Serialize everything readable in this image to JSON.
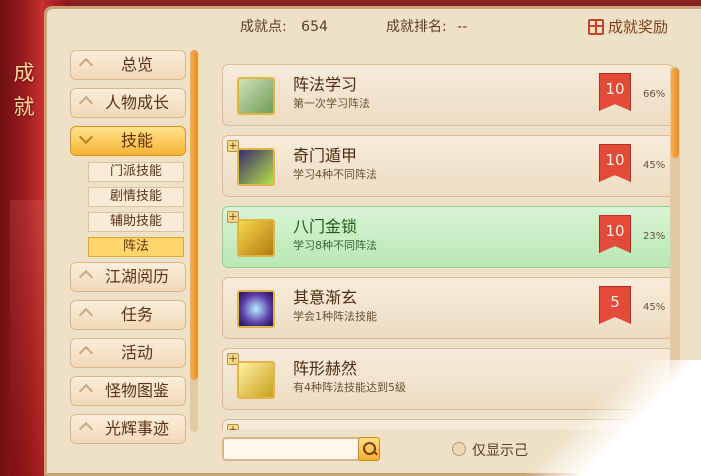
{
  "side_title": [
    "成",
    "就"
  ],
  "header": {
    "points_label": "成就点:",
    "points_value": "654",
    "rank_label": "成就排名:",
    "rank_value": "--",
    "reward_label": "成就奖励"
  },
  "menu": {
    "items": [
      {
        "label": "总览",
        "active": false
      },
      {
        "label": "人物成长",
        "active": false
      },
      {
        "label": "技能",
        "active": true
      },
      {
        "label": "江湖阅历",
        "active": false
      },
      {
        "label": "任务",
        "active": false
      },
      {
        "label": "活动",
        "active": false
      },
      {
        "label": "怪物图鉴",
        "active": false
      },
      {
        "label": "光辉事迹",
        "active": false
      }
    ],
    "sub_items": [
      {
        "label": "门派技能",
        "active": false
      },
      {
        "label": "剧情技能",
        "active": false
      },
      {
        "label": "辅助技能",
        "active": false
      },
      {
        "label": "阵法",
        "active": true
      }
    ]
  },
  "achievements": [
    {
      "title": "阵法学习",
      "desc": "第一次学习阵法",
      "points": "10",
      "percent": "66%",
      "icon": "scroll-icon",
      "has_plus": false,
      "highlight": false
    },
    {
      "title": "奇门遁甲",
      "desc": "学习4种不同阵法",
      "points": "10",
      "percent": "45%",
      "icon": "talisman-icon",
      "has_plus": true,
      "highlight": false
    },
    {
      "title": "八门金锁",
      "desc": "学习8种不同阵法",
      "points": "10",
      "percent": "23%",
      "icon": "gate-icon",
      "has_plus": true,
      "highlight": true
    },
    {
      "title": "其意渐玄",
      "desc": "学会1种阵法技能",
      "points": "5",
      "percent": "45%",
      "icon": "vortex-icon",
      "has_plus": false,
      "highlight": false
    },
    {
      "title": "阵形赫然",
      "desc": "有4种阵法技能达到5级",
      "points": "",
      "percent": "",
      "icon": "formation-icon",
      "has_plus": true,
      "highlight": false
    }
  ],
  "footer": {
    "search_placeholder": "",
    "toggle_label": "仅显示己"
  },
  "colors": {
    "accent": "#f5b435",
    "highlight_row": "#c8ecc4",
    "badge": "#e34a3a"
  }
}
